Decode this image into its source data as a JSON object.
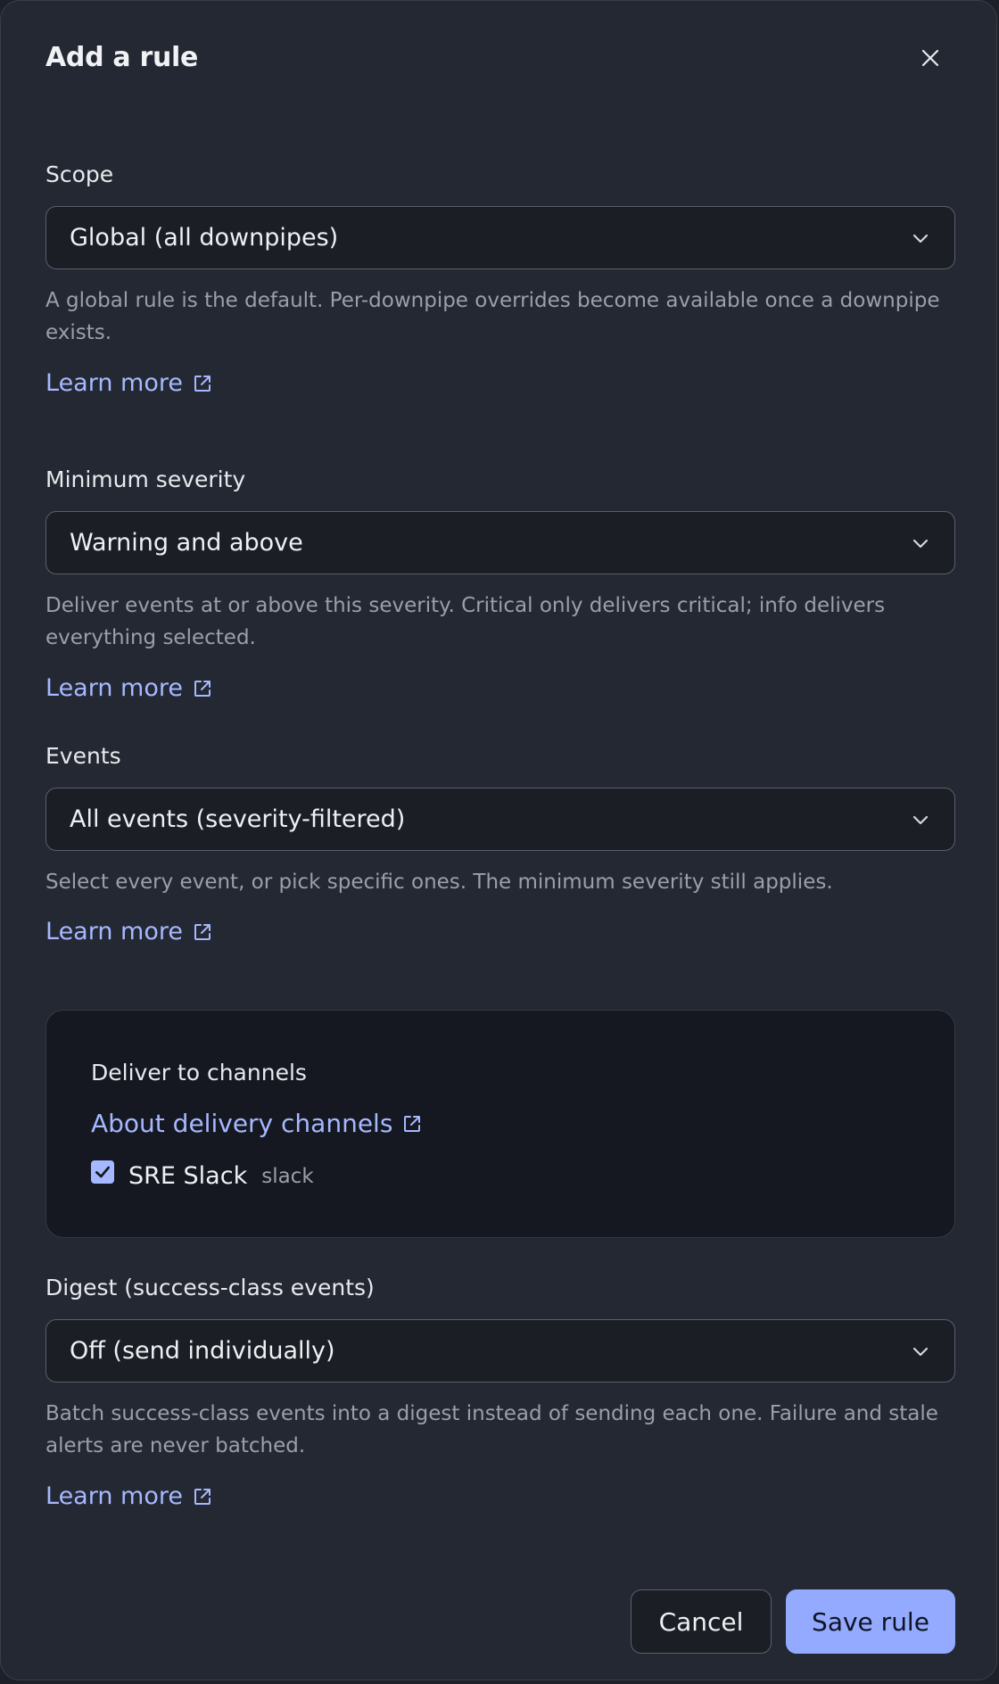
{
  "dialog": {
    "title": "Add a rule"
  },
  "scope": {
    "label": "Scope",
    "value": "Global (all downpipes)",
    "help": "A global rule is the default. Per-downpipe overrides become available once a downpipe exists.",
    "learn_more": "Learn more"
  },
  "severity": {
    "label": "Minimum severity",
    "value": "Warning and above",
    "help": "Deliver events at or above this severity. Critical only delivers critical; info delivers everything selected.",
    "learn_more": "Learn more"
  },
  "events": {
    "label": "Events",
    "value": "All events (severity-filtered)",
    "help": "Select every event, or pick specific ones. The minimum severity still applies.",
    "learn_more": "Learn more"
  },
  "channels": {
    "title": "Deliver to channels",
    "about_link": "About delivery channels",
    "items": [
      {
        "name": "SRE Slack",
        "type": "slack",
        "checked": true
      }
    ]
  },
  "digest": {
    "label": "Digest (success-class events)",
    "value": "Off (send individually)",
    "help": "Batch success-class events into a digest instead of sending each one. Failure and stale alerts are never batched.",
    "learn_more": "Learn more"
  },
  "footer": {
    "cancel_label": "Cancel",
    "save_label": "Save rule"
  },
  "icons": {
    "close": "close-icon",
    "chevron": "chevron-down-icon",
    "external": "external-link-icon",
    "check": "check-icon"
  },
  "colors": {
    "background": "#242832",
    "accent": "#a6b8ff",
    "primary_button": "#93aaff"
  }
}
